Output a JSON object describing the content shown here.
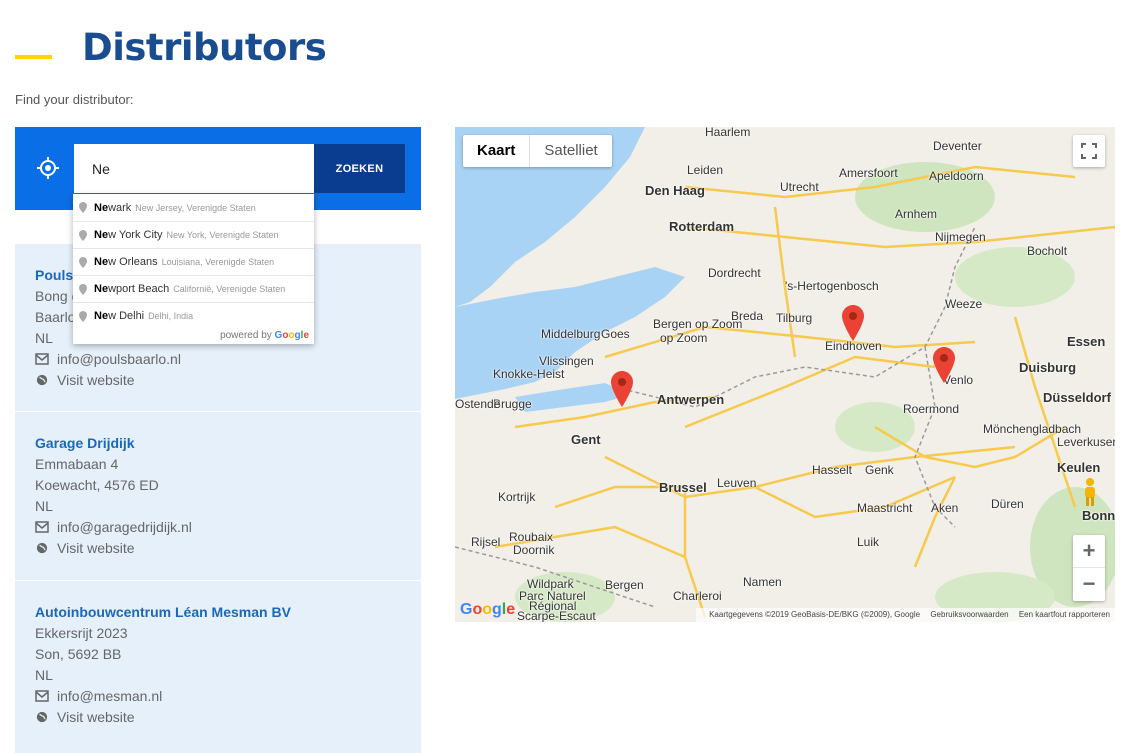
{
  "page": {
    "title": "Distributors",
    "subtitle": "Find your distributor:",
    "accent": "#ffd500",
    "title_color": "#1a4d8f"
  },
  "search": {
    "value": "Ne",
    "button_label": "ZOEKEN",
    "panel_color": "#0a6ee6",
    "button_color": "#0a3d8f",
    "locate_icon": "crosshair-icon"
  },
  "autocomplete": {
    "items": [
      {
        "match": "Ne",
        "rest": "wark",
        "secondary": "New Jersey, Verenigde Staten"
      },
      {
        "match": "Ne",
        "rest": "w York City",
        "secondary": "New York, Verenigde Staten"
      },
      {
        "match": "Ne",
        "rest": "w Orleans",
        "secondary": "Louisiana, Verenigde Staten"
      },
      {
        "match": "Ne",
        "rest": "wport Beach",
        "secondary": "Californië, Verenigde Staten"
      },
      {
        "match": "Ne",
        "rest": "w Delhi",
        "secondary": "Delhi, India"
      }
    ],
    "footer_prefix": "powered by",
    "footer_brand": [
      "G",
      "o",
      "o",
      "g",
      "l",
      "e"
    ]
  },
  "distributors": [
    {
      "name": "Pouls",
      "street": "Bong c",
      "city": "Baarlo",
      "country": "NL",
      "email": "info@poulsbaarlo.nl",
      "website": "Visit website"
    },
    {
      "name": "Garage Drijdijk",
      "street": "Emmabaan 4",
      "city": "Koewacht, 4576 ED",
      "country": "NL",
      "email": "info@garagedrijdijk.nl",
      "website": "Visit website"
    },
    {
      "name": "Autoinbouwcentrum Léan Mesman BV",
      "street": "Ekkersrijt 2023",
      "city": "Son, 5692 BB",
      "country": "NL",
      "email": "info@mesman.nl",
      "website": "Visit website"
    }
  ],
  "map": {
    "type_options": [
      "Kaart",
      "Satelliet"
    ],
    "active_type": "Kaart",
    "zoom_in": "+",
    "zoom_out": "−",
    "logo": "Google",
    "footer": [
      "Kaartgegevens ©2019 GeoBasis-DE/BKG (©2009), Google",
      "Gebruiksvoorwaarden",
      "Een kaartfout rapporteren"
    ],
    "cities": [
      {
        "name": "Haarlem",
        "big": false
      },
      {
        "name": "Leiden",
        "big": false
      },
      {
        "name": "Den Haag",
        "big": true
      },
      {
        "name": "Utrecht",
        "big": false
      },
      {
        "name": "Amersfoort",
        "big": false
      },
      {
        "name": "Apeldoorn",
        "big": false
      },
      {
        "name": "Deventer",
        "big": false
      },
      {
        "name": "Arnhem",
        "big": false
      },
      {
        "name": "Nijmegen",
        "big": false
      },
      {
        "name": "Rotterdam",
        "big": true
      },
      {
        "name": "Dordrecht",
        "big": false
      },
      {
        "name": "'s-Hertogenbosch",
        "big": false
      },
      {
        "name": "Bocholt",
        "big": false
      },
      {
        "name": "Bergen op Zoom",
        "big": false
      },
      {
        "name": "Breda",
        "big": false
      },
      {
        "name": "Tilburg",
        "big": false
      },
      {
        "name": "Middelburg",
        "big": false
      },
      {
        "name": "Goes",
        "big": false
      },
      {
        "name": "Vlissingen",
        "big": false
      },
      {
        "name": "Eindhoven",
        "big": false
      },
      {
        "name": "Weeze",
        "big": false
      },
      {
        "name": "Essen",
        "big": true
      },
      {
        "name": "Duisburg",
        "big": true
      },
      {
        "name": "Venlo",
        "big": false
      },
      {
        "name": "Knokke-Heist",
        "big": false
      },
      {
        "name": "Brugge",
        "big": false
      },
      {
        "name": "Antwerpen",
        "big": true
      },
      {
        "name": "Roermond",
        "big": false
      },
      {
        "name": "Düsseldorf",
        "big": true
      },
      {
        "name": "Gent",
        "big": true
      },
      {
        "name": "Mönchengladbach",
        "big": false
      },
      {
        "name": "Leverkusen",
        "big": false
      },
      {
        "name": "Hasselt",
        "big": false
      },
      {
        "name": "Genk",
        "big": false
      },
      {
        "name": "Keulen",
        "big": true
      },
      {
        "name": "Kortrijk",
        "big": false
      },
      {
        "name": "Brussel",
        "big": true
      },
      {
        "name": "Leuven",
        "big": false
      },
      {
        "name": "Düren",
        "big": false
      },
      {
        "name": "Maastricht",
        "big": false
      },
      {
        "name": "Aken",
        "big": false
      },
      {
        "name": "Bonn",
        "big": true
      },
      {
        "name": "Rijsel",
        "big": false
      },
      {
        "name": "Roubaix",
        "big": false
      },
      {
        "name": "Doornik",
        "big": false
      },
      {
        "name": "Luik",
        "big": false
      },
      {
        "name": "Wildpark",
        "big": false
      },
      {
        "name": "Parc Naturel",
        "big": false
      },
      {
        "name": "Régional",
        "big": false
      },
      {
        "name": "Scarpe-Escaut",
        "big": false
      },
      {
        "name": "Bergen",
        "big": false
      },
      {
        "name": "Charleroi",
        "big": false
      },
      {
        "name": "Namen",
        "big": false
      },
      {
        "name": "Ostende",
        "big": false
      },
      {
        "name": "Essen",
        "big": false
      }
    ]
  }
}
